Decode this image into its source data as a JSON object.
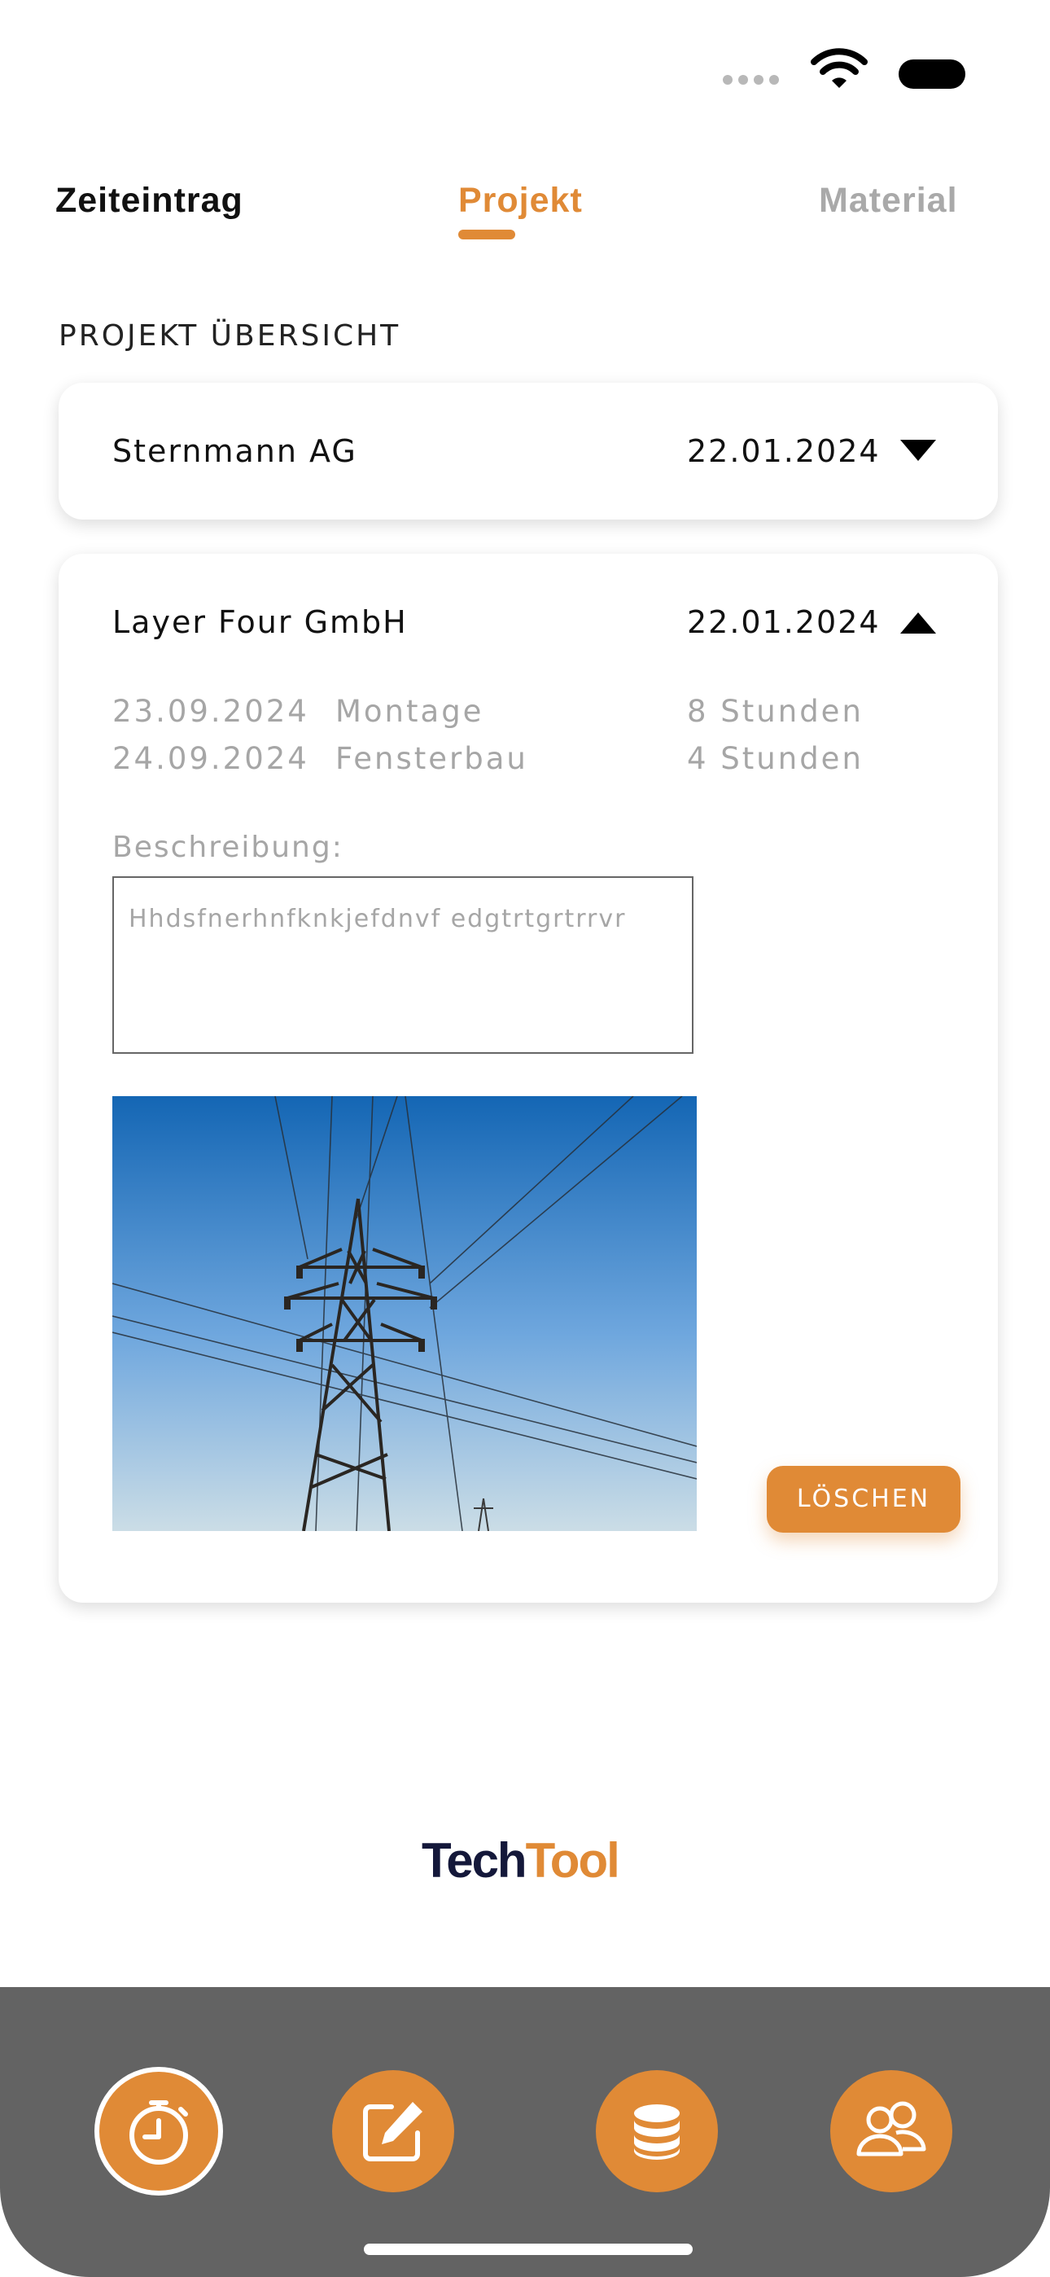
{
  "status_bar": {
    "icons": [
      "signal-dots-icon",
      "wifi-icon",
      "battery-icon"
    ]
  },
  "tabs": [
    {
      "label": "Zeiteintrag",
      "state": "inactive"
    },
    {
      "label": "Projekt",
      "state": "active"
    },
    {
      "label": "Material",
      "state": "disabled"
    }
  ],
  "section_title": "PROJEKT ÜBERSICHT",
  "projects": [
    {
      "name": "Sternmann AG",
      "date": "22.01.2024",
      "expanded": false
    },
    {
      "name": "Layer Four GmbH",
      "date": "22.01.2024",
      "expanded": true,
      "entries": [
        {
          "date": "23.09.2024",
          "task": "Montage",
          "hours": "8 Stunden"
        },
        {
          "date": "24.09.2024",
          "task": "Fensterbau",
          "hours": "4 Stunden"
        }
      ],
      "description_label": "Beschreibung:",
      "description_text": "Hhdsfnerhnfknkjefdnvf edgtrtgrtrrvr",
      "delete_label": "LÖSCHEN"
    }
  ],
  "logo": {
    "part1": "Tech",
    "part2": "Tool"
  },
  "nav": {
    "items": [
      "timer-icon",
      "edit-icon",
      "database-icon",
      "users-icon"
    ],
    "active_index": 0
  },
  "colors": {
    "accent": "#e08a36",
    "navbar": "#636363",
    "logo_dark": "#14183a",
    "muted": "#a6a6a6"
  }
}
